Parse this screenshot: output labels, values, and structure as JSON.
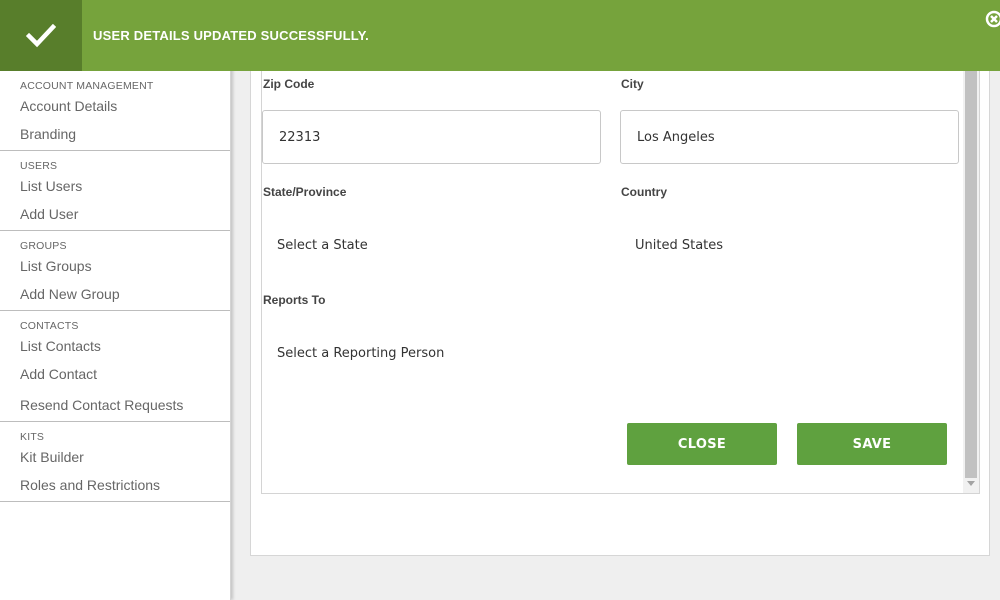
{
  "banner": {
    "message": "USER DETAILS UPDATED SUCCESSFULLY.",
    "check_icon": "check-icon",
    "close_icon": "close-circle-icon",
    "color": "#76a33c",
    "icon_bg_color": "#587e2b"
  },
  "sidebar": {
    "sections": [
      {
        "heading": "ACCOUNT MANAGEMENT",
        "items": [
          "Account Details",
          "Branding"
        ]
      },
      {
        "heading": "USERS",
        "items": [
          "List Users",
          "Add User"
        ]
      },
      {
        "heading": "GROUPS",
        "items": [
          "List Groups",
          "Add New Group"
        ]
      },
      {
        "heading": "CONTACTS",
        "items": [
          "List Contacts",
          "Add Contact",
          "Resend Contact Requests"
        ]
      },
      {
        "heading": "KITS",
        "items": [
          "Kit Builder",
          "Roles and Restrictions"
        ]
      }
    ]
  },
  "form": {
    "zip": {
      "label": "Zip Code",
      "value": "22313"
    },
    "city": {
      "label": "City",
      "value": "Los Angeles"
    },
    "state": {
      "label": "State/Province",
      "value": "Select a State"
    },
    "country": {
      "label": "Country",
      "value": "United States"
    },
    "reports_to": {
      "label": "Reports To",
      "value": "Select a Reporting Person"
    }
  },
  "buttons": {
    "close": "CLOSE",
    "save": "SAVE",
    "color": "#5fa13f"
  }
}
